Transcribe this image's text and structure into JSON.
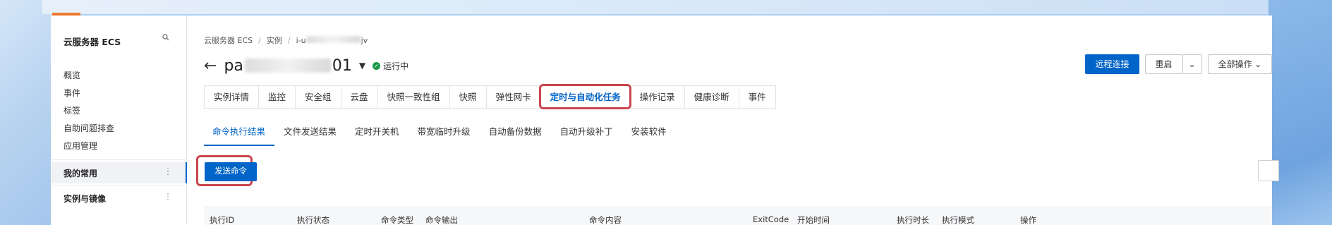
{
  "sidebar": {
    "title": "云服务器 ECS",
    "search_icon": "search-icon",
    "items": [
      "概览",
      "事件",
      "标签",
      "自助问题排查",
      "应用管理"
    ],
    "groups": [
      {
        "label": "我的常用",
        "active": true
      },
      {
        "label": "实例与镜像",
        "active": false
      }
    ]
  },
  "breadcrumb": {
    "items": [
      "云服务器 ECS",
      "实例"
    ],
    "instance_id_prefix": "i-u",
    "instance_id_suffix": "jv"
  },
  "instance": {
    "name_prefix": "pa",
    "name_suffix": "01",
    "status": "运行中"
  },
  "actions": {
    "remote": "远程连接",
    "restart": "重启",
    "all_actions": "全部操作"
  },
  "tabs": [
    "实例详情",
    "监控",
    "安全组",
    "云盘",
    "快照一致性组",
    "快照",
    "弹性网卡",
    "定时与自动化任务",
    "操作记录",
    "健康诊断",
    "事件"
  ],
  "active_tab": "定时与自动化任务",
  "subtabs": [
    "命令执行结果",
    "文件发送结果",
    "定时开关机",
    "带宽临时升级",
    "自动备份数据",
    "自动升级补丁",
    "安装软件"
  ],
  "active_subtab": "命令执行结果",
  "send_command_label": "发送命令",
  "table": {
    "columns": [
      "执行ID",
      "执行状态",
      "命令类型",
      "命令输出",
      "命令内容",
      "ExitCode",
      "开始时间",
      "执行时长",
      "执行模式",
      "操作"
    ]
  },
  "colors": {
    "primary": "#0064c8",
    "highlight": "#c9464f",
    "status_green": "#1a9a4a"
  }
}
